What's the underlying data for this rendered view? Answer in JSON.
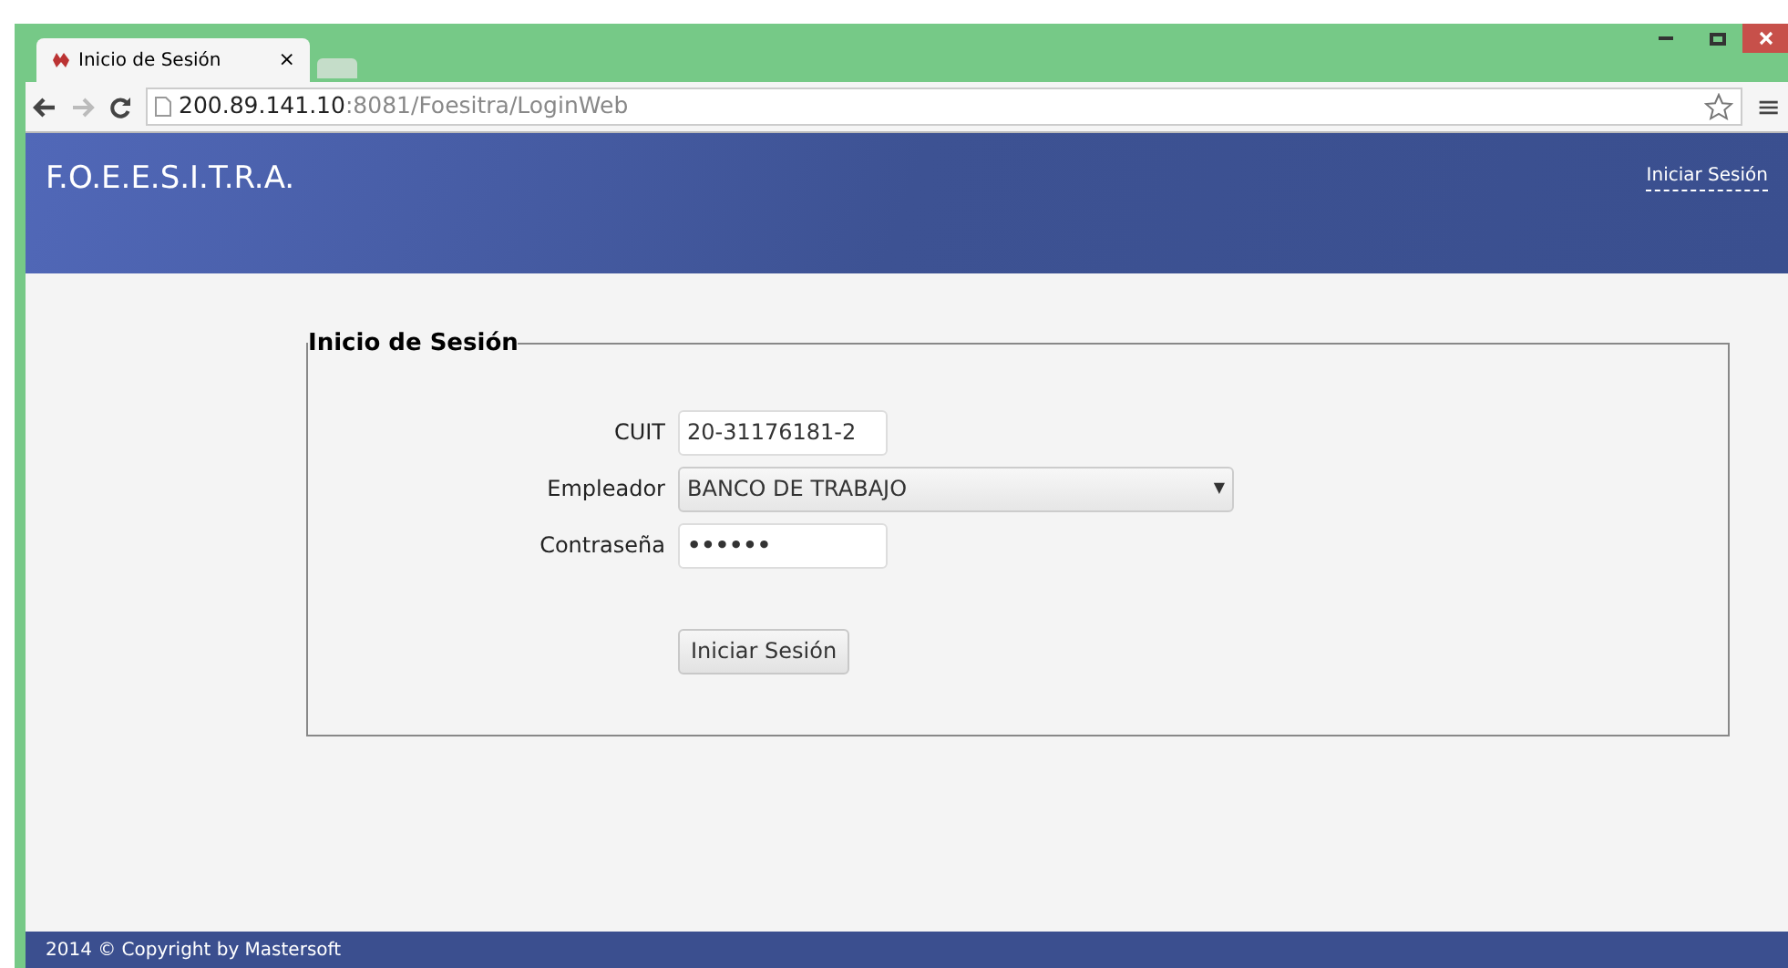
{
  "browser": {
    "tabs": [
      {
        "title": "Inicio de Sesión",
        "selected": true,
        "close": "×"
      },
      {
        "selected": false
      }
    ],
    "address": {
      "host": "200.89.141.10",
      "rest": ":8081/Foesitra/LoginWeb"
    },
    "menu": "≡"
  },
  "header": {
    "brand": "F.O.E.E.S.I.T.R.A.",
    "link": "Iniciar Sesión"
  },
  "login": {
    "legend": "Inicio de Sesión",
    "fields": [
      {
        "kind": "text",
        "label": "CUIT",
        "value": "20-31176181-2"
      },
      {
        "kind": "select",
        "label": "Empleador",
        "value": "BANCO DE TRABAJO",
        "arrow": "▼"
      },
      {
        "kind": "password",
        "label": "Contraseña",
        "value": "••••••"
      }
    ],
    "button": "Iniciar Sesión"
  },
  "footer": "2014 © Copyright by Mastersoft"
}
